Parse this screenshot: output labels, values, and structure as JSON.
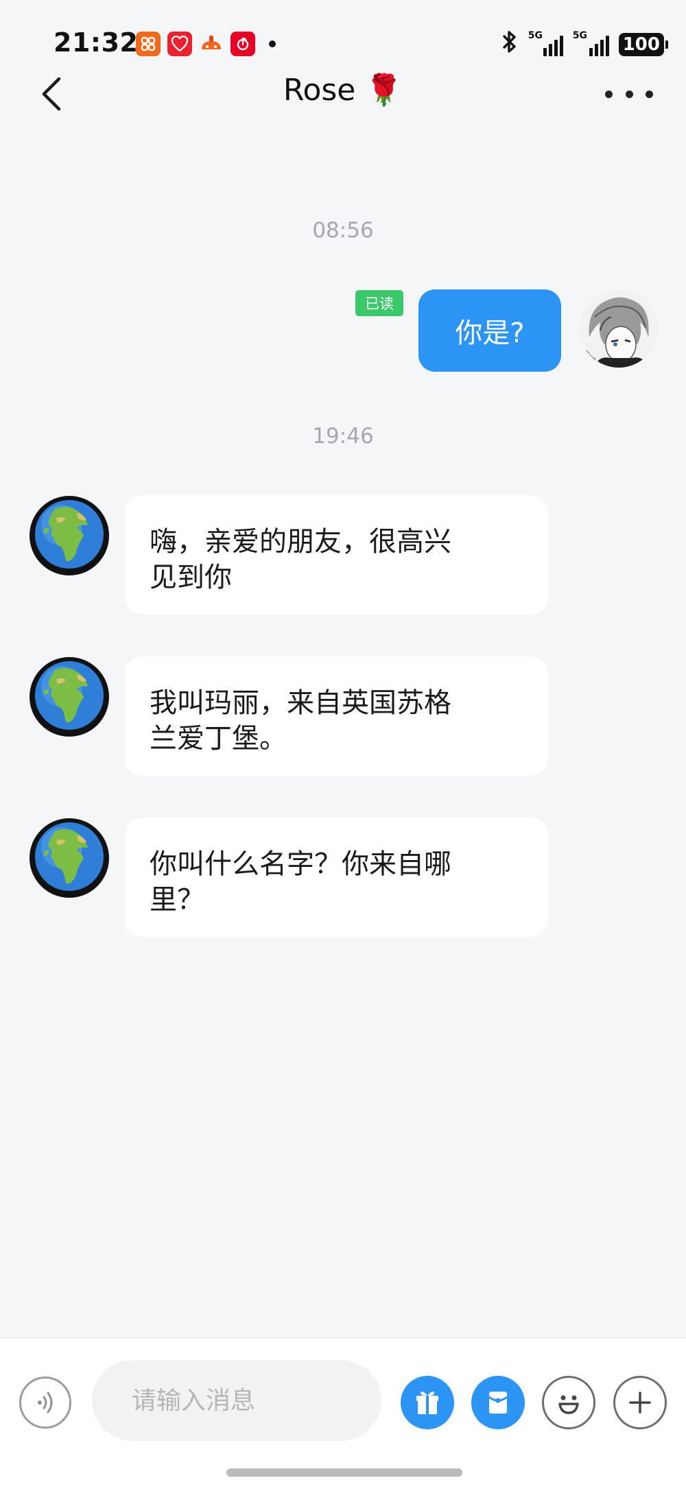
{
  "status_bar": {
    "time": "21:32",
    "app_icons": [
      "meituan-app-icon",
      "xiaohongshu-app-icon",
      "taobao-app-icon",
      "netease-music-app-icon"
    ],
    "signal1_label": "5G",
    "signal2_label": "5G",
    "battery": "100"
  },
  "header": {
    "title": "Rose 🌹"
  },
  "messages": [
    {
      "timestamp": "08:56"
    },
    {
      "direction": "outgoing",
      "read_badge": "已读",
      "text": "你是?"
    },
    {
      "timestamp": "19:46"
    },
    {
      "direction": "incoming",
      "lines": [
        "嗨，亲爱的朋友，很高兴",
        "见到你"
      ]
    },
    {
      "direction": "incoming",
      "lines": [
        "我叫玛丽，来自英国苏格",
        "兰爱丁堡。"
      ]
    },
    {
      "direction": "incoming",
      "lines": [
        "你叫什么名字？你来自哪",
        "里？"
      ]
    }
  ],
  "input_bar": {
    "placeholder": "请输入消息",
    "value": ""
  },
  "colors": {
    "accent_blue": "#2b94f5",
    "read_badge_green": "#3bc86a",
    "background": "#f4f6f9"
  },
  "icons": {
    "back": "chevron-left-icon",
    "more": "more-horizontal-icon",
    "voice": "voice-icon",
    "gift": "gift-icon",
    "red_packet": "red-packet-icon",
    "emoji": "emoji-icon",
    "plus": "plus-icon"
  }
}
